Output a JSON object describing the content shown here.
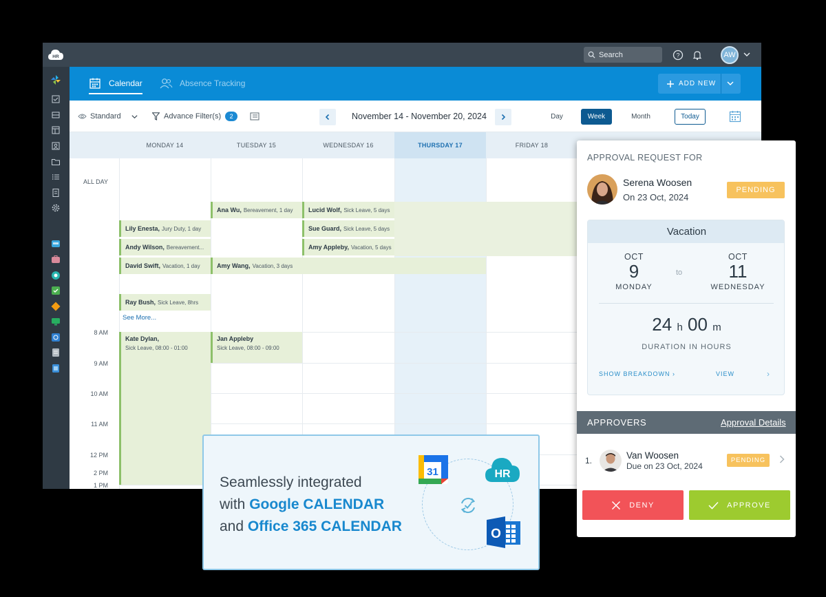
{
  "app": {
    "logo_text": "HR",
    "search_placeholder": "Search",
    "user_initials": "AW"
  },
  "topbar": {
    "tab_calendar": "Calendar",
    "tab_absence": "Absence Tracking",
    "add_new": "ADD NEW"
  },
  "toolbar": {
    "view_preset": "Standard",
    "filter_label": "Advance Filter(s)",
    "filter_count": "2",
    "date_range": "November 14 - November 20, 2024",
    "views": [
      "Day",
      "Week",
      "Month"
    ],
    "active_view": "Week",
    "today": "Today"
  },
  "calendar": {
    "days": [
      "MONDAY 14",
      "TUESDAY 15",
      "WEDNESDAY 16",
      "THURSDAY 17",
      "FRIDAY 18"
    ],
    "highlighted_day": "THURSDAY 17",
    "all_day_label": "ALL DAY",
    "see_more": "See More...",
    "times": [
      "8 AM",
      "9 AM",
      "10 AM",
      "11 AM",
      "12 PM",
      "1 PM",
      "2 PM"
    ],
    "events": [
      {
        "name": "Ana Wu,",
        "detail": "Bereavement, 1 day"
      },
      {
        "name": "Lucid Wolf,",
        "detail": "Sick Leave, 5 days"
      },
      {
        "name": "Lily Enesta,",
        "detail": "Jury Duty, 1 day"
      },
      {
        "name": "Sue Guard,",
        "detail": "Sick Leave, 5 days"
      },
      {
        "name": "Andy Wilson,",
        "detail": "Bereavement..."
      },
      {
        "name": "Amy Appleby,",
        "detail": "Vacation, 5 days"
      },
      {
        "name": "David Swift,",
        "detail": "Vacation, 1 day"
      },
      {
        "name": "Amy Wang,",
        "detail": "Vacation, 3 days"
      },
      {
        "name": "Ray Bush,",
        "detail": "Sick Leave, 8hrs"
      },
      {
        "name": "Kate Dylan,",
        "detail": "Sick Leave, 08:00 - 01:00"
      },
      {
        "name": "Jan Appleby",
        "detail": "Sick Leave, 08:00 - 09:00"
      }
    ]
  },
  "approval": {
    "heading": "APPROVAL REQUEST FOR",
    "requester_name": "Serena Woosen",
    "requester_date": "On 23 Oct, 2024",
    "status": "PENDING",
    "leave_type": "Vacation",
    "from": {
      "month": "OCT",
      "day": "9",
      "weekday": "MONDAY"
    },
    "to_label": "to",
    "to": {
      "month": "OCT",
      "day": "11",
      "weekday": "WEDNESDAY"
    },
    "duration_hours": "24",
    "duration_h_unit": "h",
    "duration_minutes": "00",
    "duration_m_unit": "m",
    "duration_label": "DURATION IN HOURS",
    "show_breakdown": "SHOW BREAKDOWN",
    "view": "VIEW",
    "approvers_label": "APPROVERS",
    "approval_details": "Approval Details",
    "approver": {
      "index": "1.",
      "name": "Van Woosen",
      "due": "Due on 23 Oct, 2024",
      "status": "PENDING"
    },
    "deny": "DENY",
    "approve": "APPROVE"
  },
  "banner": {
    "line1": "Seamlessly integrated",
    "line2_prefix": "with ",
    "line2_highlight": "Google CALENDAR",
    "line3_prefix": "and ",
    "line3_highlight": "Office 365 CALENDAR",
    "gcal_number": "31",
    "hr_logo_text": "HR",
    "outlook_letter": "O"
  },
  "colors": {
    "primary_blue": "#0a8bd6",
    "dark_nav": "#3a4651",
    "event_green": "#e7f0d9",
    "pending": "#f7c25d",
    "deny": "#f25358",
    "approve": "#9dcb2f"
  }
}
